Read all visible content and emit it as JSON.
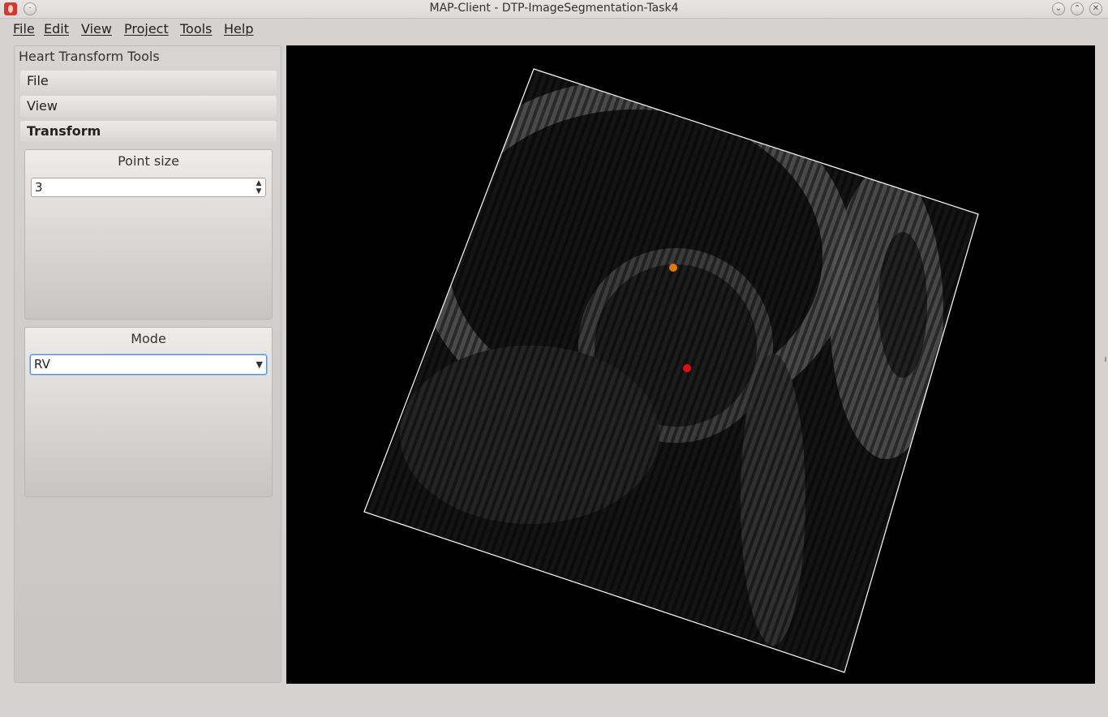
{
  "window": {
    "title": "MAP-Client - DTP-ImageSegmentation-Task4"
  },
  "menubar": {
    "items": [
      "File",
      "Edit",
      "View",
      "Project",
      "Tools",
      "Help"
    ]
  },
  "panel": {
    "title": "Heart Transform Tools",
    "sections": {
      "file": "File",
      "view": "View",
      "transform": "Transform"
    },
    "point_size": {
      "label": "Point size",
      "value": "3"
    },
    "mode": {
      "label": "Mode",
      "selected": "RV"
    }
  },
  "viewer": {
    "description_icon": "mri-slice-icon",
    "markers": [
      {
        "name": "orange-marker",
        "color": "#e07a10"
      },
      {
        "name": "red-marker",
        "color": "#e01010"
      }
    ]
  },
  "colors": {
    "viewer_background": "#000000",
    "frame_border": "#ffffff"
  }
}
